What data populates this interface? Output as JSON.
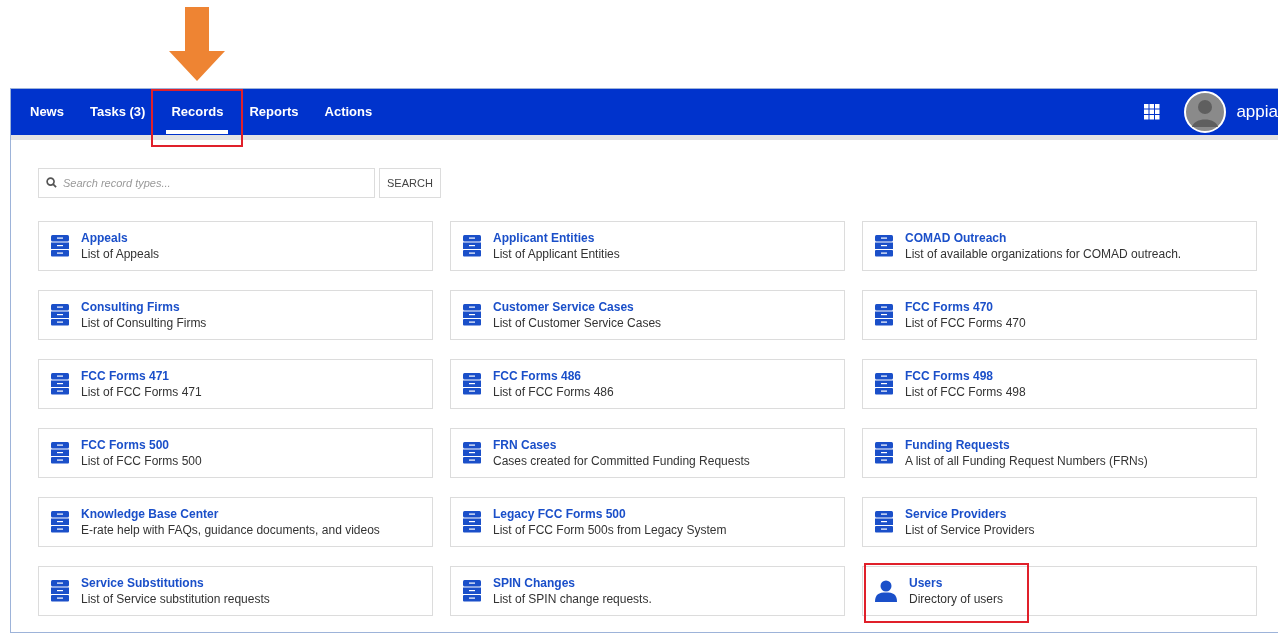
{
  "nav": {
    "tabs": [
      {
        "label": "News",
        "selected": false,
        "highlighted": false,
        "pointed": false
      },
      {
        "label": "Tasks (3)",
        "selected": false,
        "highlighted": false,
        "pointed": false
      },
      {
        "label": "Records",
        "selected": true,
        "highlighted": true,
        "pointed": true
      },
      {
        "label": "Reports",
        "selected": false,
        "highlighted": false,
        "pointed": false
      },
      {
        "label": "Actions",
        "selected": false,
        "highlighted": false,
        "pointed": false
      }
    ],
    "brand": "appia"
  },
  "search": {
    "placeholder": "Search record types...",
    "button": "SEARCH"
  },
  "records": [
    {
      "kind": "record",
      "title": "Appeals",
      "description": "List of Appeals",
      "highlighted": false
    },
    {
      "kind": "record",
      "title": "Applicant Entities",
      "description": "List of Applicant Entities",
      "highlighted": false
    },
    {
      "kind": "record",
      "title": "COMAD Outreach",
      "description": "List of available organizations for COMAD outreach.",
      "highlighted": false
    },
    {
      "kind": "record",
      "title": "Consulting Firms",
      "description": "List of Consulting Firms",
      "highlighted": false
    },
    {
      "kind": "record",
      "title": "Customer Service Cases",
      "description": "List of Customer Service Cases",
      "highlighted": false
    },
    {
      "kind": "record",
      "title": "FCC Forms 470",
      "description": "List of FCC Forms 470",
      "highlighted": false
    },
    {
      "kind": "record",
      "title": "FCC Forms 471",
      "description": "List of FCC Forms 471",
      "highlighted": false
    },
    {
      "kind": "record",
      "title": "FCC Forms 486",
      "description": "List of FCC Forms 486",
      "highlighted": false
    },
    {
      "kind": "record",
      "title": "FCC Forms 498",
      "description": "List of FCC Forms 498",
      "highlighted": false
    },
    {
      "kind": "record",
      "title": "FCC Forms 500",
      "description": "List of FCC Forms 500",
      "highlighted": false
    },
    {
      "kind": "record",
      "title": "FRN Cases",
      "description": "Cases created for Committed Funding Requests",
      "highlighted": false
    },
    {
      "kind": "record",
      "title": "Funding Requests",
      "description": "A list of all Funding Request Numbers (FRNs)",
      "highlighted": false
    },
    {
      "kind": "record",
      "title": "Knowledge Base Center",
      "description": "E-rate help with FAQs, guidance documents, and videos",
      "highlighted": false
    },
    {
      "kind": "record",
      "title": "Legacy FCC Forms 500",
      "description": "List of FCC Form 500s from Legacy System",
      "highlighted": false
    },
    {
      "kind": "record",
      "title": "Service Providers",
      "description": "List of Service Providers",
      "highlighted": false
    },
    {
      "kind": "record",
      "title": "Service Substitutions",
      "description": "List of Service substitution requests",
      "highlighted": false
    },
    {
      "kind": "record",
      "title": "SPIN Changes",
      "description": "List of SPIN change requests.",
      "highlighted": false
    },
    {
      "kind": "user",
      "title": "Users",
      "description": "Directory of users",
      "highlighted": true
    }
  ]
}
